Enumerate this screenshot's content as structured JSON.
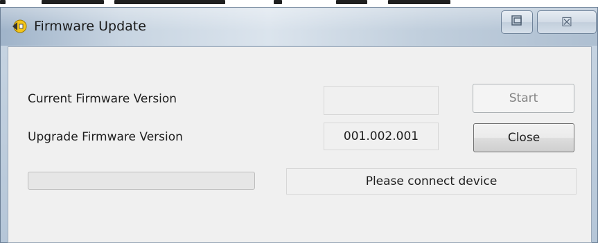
{
  "window": {
    "title": "Firmware Update",
    "app_icon": "speaker-icon",
    "title_buttons": [
      "restore-icon",
      "close-icon"
    ],
    "close_glyph": "☒"
  },
  "form": {
    "current_label": "Current Firmware Version",
    "current_value": "",
    "upgrade_label": "Upgrade Firmware Version",
    "upgrade_value": "001.002.001",
    "start_label": "Start",
    "close_label": "Close",
    "progress": 0,
    "status": "Please connect device"
  },
  "colors": {
    "progress_fill": "#06b025",
    "disabled_text": "#838383"
  }
}
